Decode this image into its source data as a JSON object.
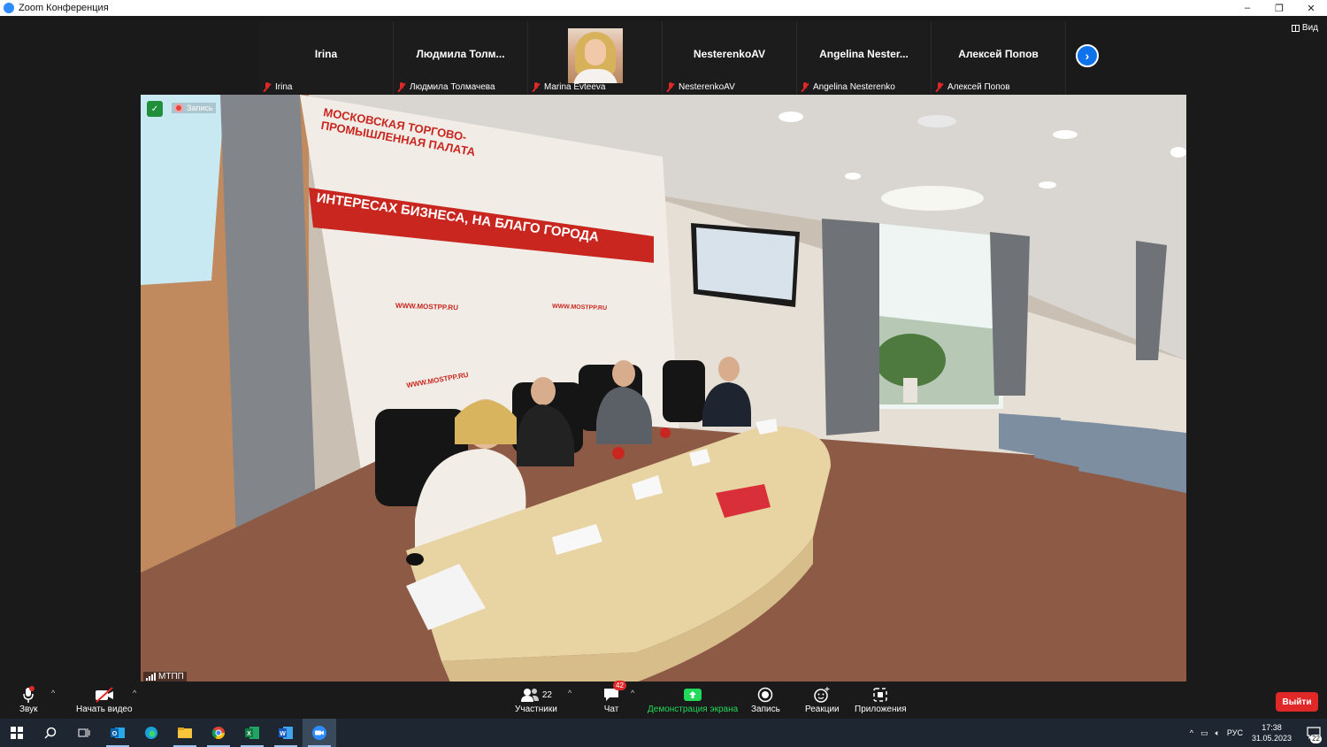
{
  "window": {
    "title": "Zoom Конференция",
    "minimize": "–",
    "restore": "❐",
    "close": "✕"
  },
  "view_button": "Вид",
  "participants_strip": [
    {
      "big_name": "Irina",
      "small_name": "Irina",
      "muted": true,
      "has_photo": false
    },
    {
      "big_name": "Людмила  Толм...",
      "small_name": "Людмила Толмачева",
      "muted": true,
      "has_photo": false
    },
    {
      "big_name": "",
      "small_name": "Marina Evteeva",
      "muted": true,
      "has_photo": true
    },
    {
      "big_name": "NesterenkoAV",
      "small_name": "NesterenkoAV",
      "muted": true,
      "has_photo": false
    },
    {
      "big_name": "Angelina  Nester...",
      "small_name": "Angelina Nesterenko",
      "muted": true,
      "has_photo": false
    },
    {
      "big_name": "Алексей Попов",
      "small_name": "Алексей Попов",
      "muted": true,
      "has_photo": false
    }
  ],
  "main_video": {
    "recording_label": "Запись",
    "speaker_name": "МТПП",
    "banner_title": "МОСКОВСКАЯ ТОРГОВО-ПРОМЫШЛЕННАЯ ПАЛАТА",
    "banner_slogan": "ИНТЕРЕСАХ БИЗНЕСА, НА БЛАГО ГОРОДА",
    "banner_site_1": "WWW.MOSTPP.RU",
    "banner_site_2": "WWW.MOSTPP.RU",
    "banner_site_3": "WWW.MOSTPP.RU"
  },
  "toolbar": {
    "audio_label": "Звук",
    "video_label": "Начать видео",
    "participants_label": "Участники",
    "participants_count": "22",
    "chat_label": "Чат",
    "chat_badge": "42",
    "share_label": "Демонстрация экрана",
    "record_label": "Запись",
    "reactions_label": "Реакции",
    "apps_label": "Приложения",
    "leave_label": "Выйти"
  },
  "taskbar": {
    "language": "РУС",
    "time": "17:38",
    "date": "31.05.2023",
    "notifications": "22"
  },
  "colors": {
    "accent_blue": "#0e72ed",
    "leave_red": "#e02828",
    "share_green": "#23d959",
    "banner_red": "#c8261f"
  }
}
